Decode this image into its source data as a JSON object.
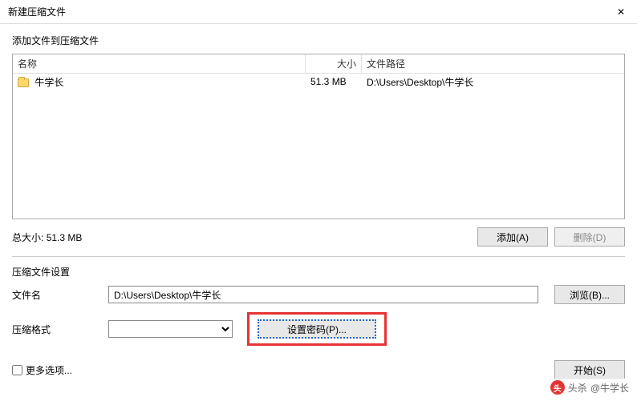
{
  "window": {
    "title": "新建压缩文件"
  },
  "section": {
    "add_label": "添加文件到压缩文件",
    "settings_label": "压缩文件设置"
  },
  "table": {
    "headers": {
      "name": "名称",
      "size": "大小",
      "path": "文件路径"
    },
    "rows": [
      {
        "name": "牛学长",
        "size": "51.3 MB",
        "path": "D:\\Users\\Desktop\\牛学长"
      }
    ]
  },
  "total": {
    "label": "总大小:",
    "value": "51.3 MB"
  },
  "buttons": {
    "add": "添加(A)",
    "delete": "删除(D)",
    "browse": "浏览(B)...",
    "set_password": "设置密码(P)...",
    "start": "开始(S)"
  },
  "settings": {
    "filename_label": "文件名",
    "filename_value": "D:\\Users\\Desktop\\牛学长",
    "format_label": "压缩格式",
    "format_value": ""
  },
  "footer": {
    "more_options": "更多选项..."
  },
  "watermark": {
    "prefix": "头杀",
    "text": "@牛学长"
  }
}
